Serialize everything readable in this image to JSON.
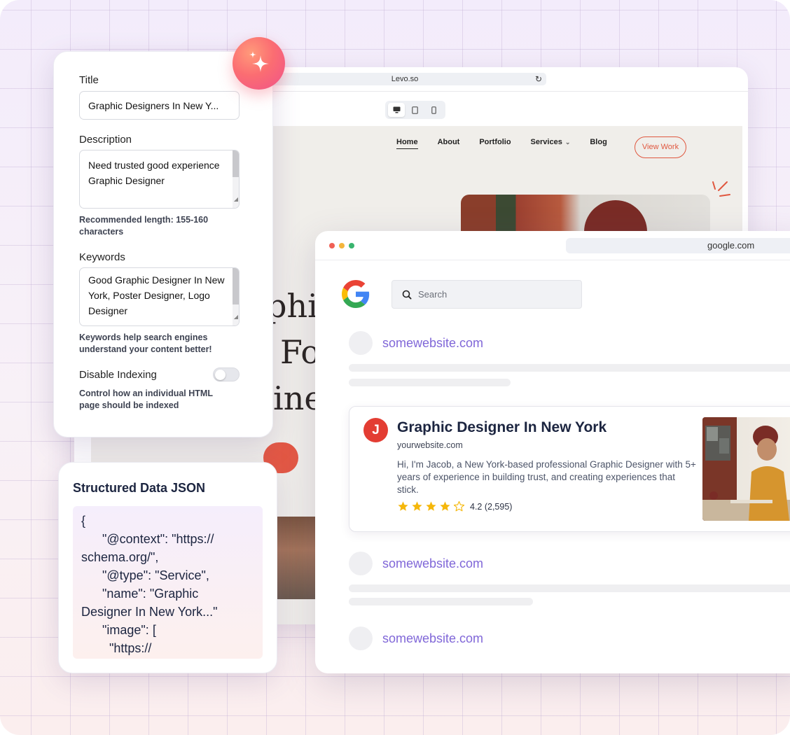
{
  "levo": {
    "url": "Levo.so",
    "nav": [
      {
        "label": "Home"
      },
      {
        "label": "About"
      },
      {
        "label": "Portfolio"
      },
      {
        "label": "Services"
      },
      {
        "label": "Blog"
      }
    ],
    "cta_label": "View Work",
    "hero_lines": [
      "phic",
      "Fo",
      "ine"
    ]
  },
  "seo_panel": {
    "title_label": "Title",
    "title_value": "Graphic Designers In New Y...",
    "description_label": "Description",
    "description_value": "Need trusted good experience Graphic Designer",
    "description_hint": "Recommended length: 155-160 characters",
    "keywords_label": "Keywords",
    "keywords_value": "Good Graphic Designer In New York, Poster Designer, Logo Designer",
    "keywords_hint": "Keywords help search engines understand your content better!",
    "indexing_label": "Disable Indexing",
    "indexing_hint": "Control how an individual HTML page should be indexed",
    "indexing_enabled": false
  },
  "json_panel": {
    "title": "Structured Data JSON",
    "code": "{\n      \"@context\": \"https://\nschema.org/\",\n      \"@type\": \"Service\",\n      \"name\": \"Graphic\nDesigner In New York...\"\n      \"image\": [\n        \"https://"
  },
  "serp": {
    "url": "google.com",
    "search_placeholder": "Search",
    "results": [
      {
        "site": "somewebsite.com"
      },
      {
        "site": "somewebsite.com"
      },
      {
        "site": "somewebsite.com"
      }
    ],
    "featured": {
      "favicon_letter": "J",
      "title": "Graphic Designer In New York",
      "url": "yourwebsite.com",
      "description": "Hi, I'm Jacob, a New York-based professional Graphic Designer with 5+ years of experience in building trust, and creating experiences that stick.",
      "rating": 4.2,
      "rating_text": "4.2 (2,595)"
    }
  },
  "colors": {
    "accent_red": "#e0573f",
    "link_purple": "#8067d8",
    "star_yellow": "#f5b70a"
  }
}
